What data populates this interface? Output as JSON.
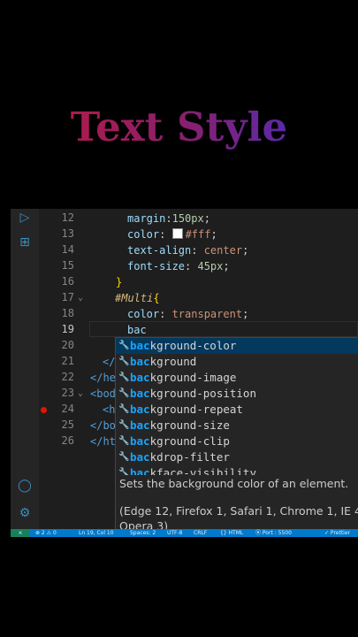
{
  "preview": {
    "title": "Text Style"
  },
  "activity_bar": {
    "icons": [
      "run-debug-icon",
      "extensions-icon",
      "account-icon",
      "settings-icon"
    ]
  },
  "editor": {
    "line_numbers": [
      "12",
      "13",
      "14",
      "15",
      "16",
      "17",
      "18",
      "19",
      "20",
      "21",
      "22",
      "23",
      "24",
      "25",
      "26"
    ],
    "lines": {
      "l12": {
        "prop": "margin",
        "punct": ":",
        "num": "150px",
        "end": ";"
      },
      "l13": {
        "prop": "color",
        "punct": ": ",
        "val": "#fff",
        "end": ";"
      },
      "l14": {
        "prop": "text-align",
        "punct": ": ",
        "val": "center",
        "end": ";"
      },
      "l15": {
        "prop": "font-size",
        "punct": ": ",
        "num": "45px",
        "end": ";"
      },
      "l16": {
        "brace": "}"
      },
      "l17": {
        "selector": "#Multi",
        "brace": "{"
      },
      "l18": {
        "prop": "color",
        "punct": ": ",
        "val": "transparent",
        "end": ";"
      },
      "l19": {
        "typed": "bac"
      },
      "l20": {
        "text": ""
      },
      "l21": {
        "tag": "</",
        "rest": "s"
      },
      "l22": {
        "tag": "</he"
      },
      "l23": {
        "tag": "<bod"
      },
      "l24": {
        "tag": "<h"
      },
      "l25": {
        "tag": "</bo"
      },
      "l26": {
        "tag": "</ht"
      }
    }
  },
  "suggestions": {
    "match_prefix": "bac",
    "items": [
      {
        "match": "bac",
        "rest": "kground-color"
      },
      {
        "match": "bac",
        "rest": "kground"
      },
      {
        "match": "bac",
        "rest": "kground-image"
      },
      {
        "match": "bac",
        "rest": "kground-position"
      },
      {
        "match": "bac",
        "rest": "kground-repeat"
      },
      {
        "match": "bac",
        "rest": "kground-size"
      },
      {
        "match": "bac",
        "rest": "kground-clip"
      },
      {
        "match": "bac",
        "rest": "kdrop-filter"
      },
      {
        "match": "bac",
        "rest": "kface-visibility"
      }
    ],
    "doc": {
      "description": "Sets the background color of an element.",
      "support": "(Edge 12, Firefox 1, Safari 1, Chrome 1, IE 4,",
      "support2": "Opera 3)"
    }
  },
  "statusbar": {
    "problems": "⊗ 2 ⚠ 0",
    "position": "Ln 19, Col 10",
    "spaces": "Spaces: 2",
    "encoding": "UTF-8",
    "eol": "CRLF",
    "language": "{} HTML",
    "port": "⦿ Port : 5500",
    "formatter": "✓ Prettier"
  },
  "colors": {
    "accent": "#007acc",
    "selection": "#04395e",
    "match": "#18a3ff",
    "title_gradient": [
      "#c0193c",
      "#3b2fd0"
    ]
  }
}
